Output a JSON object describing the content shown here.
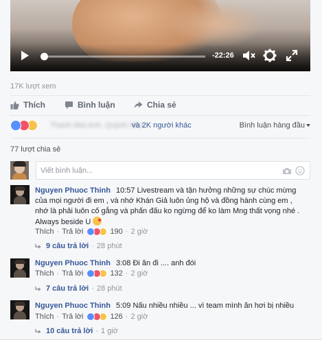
{
  "video": {
    "time_remaining": "-22:26",
    "progress_fraction": 0.01
  },
  "views_text": "17K lượt xem",
  "actions": {
    "like": "Thích",
    "comment": "Bình luận",
    "share": "Chia sẻ"
  },
  "reactions": {
    "types": [
      "like-icon",
      "love-icon",
      "haha-icon"
    ],
    "others_text": "và 2K người khác",
    "sort_label": "Bình luận hàng đầu"
  },
  "shares_text": "77 lượt chia sẻ",
  "composer": {
    "placeholder": "Viết bình luận..."
  },
  "comments": [
    {
      "author": "Nguyen Phuoc Thinh",
      "text": "10:57 Livestream và tận hưởng những sự chúc mừng của mọi người đi em , và nhớ Khán Giả luôn ủng hộ và đồng hành cùng em , nhớ là phải luôn cố gắng và phấn đấu ko ngừng để ko làm Mng thất vọng nhé . Always beside U",
      "like_label": "Thích",
      "reply_label": "Trả lời",
      "reaction_count": "190",
      "time": "2 giờ",
      "replies_label": "9 câu trả lời",
      "replies_time": "28 phút"
    },
    {
      "author": "Nguyen Phuoc Thinh",
      "text": "3:08 Đi ăn đi .... anh đói",
      "like_label": "Thích",
      "reply_label": "Trả lời",
      "reaction_count": "132",
      "time": "2 giờ",
      "replies_label": "7 câu trả lời",
      "replies_time": "28 phút"
    },
    {
      "author": "Nguyen Phuoc Thinh",
      "text": "5:09 Nấu nhiều nhiều ... vì team mình ăn hơi bị nhiều",
      "like_label": "Thích",
      "reply_label": "Trả lời",
      "reaction_count": "126",
      "time": "2 giờ",
      "replies_label": "10 câu trả lời",
      "replies_time": "1 giờ"
    }
  ],
  "colors": {
    "link_blue": "#365899",
    "like_blue": "#5890ff",
    "love_red": "#f25268",
    "haha_yellow": "#f7c34a",
    "meta_gray": "#90949c"
  }
}
